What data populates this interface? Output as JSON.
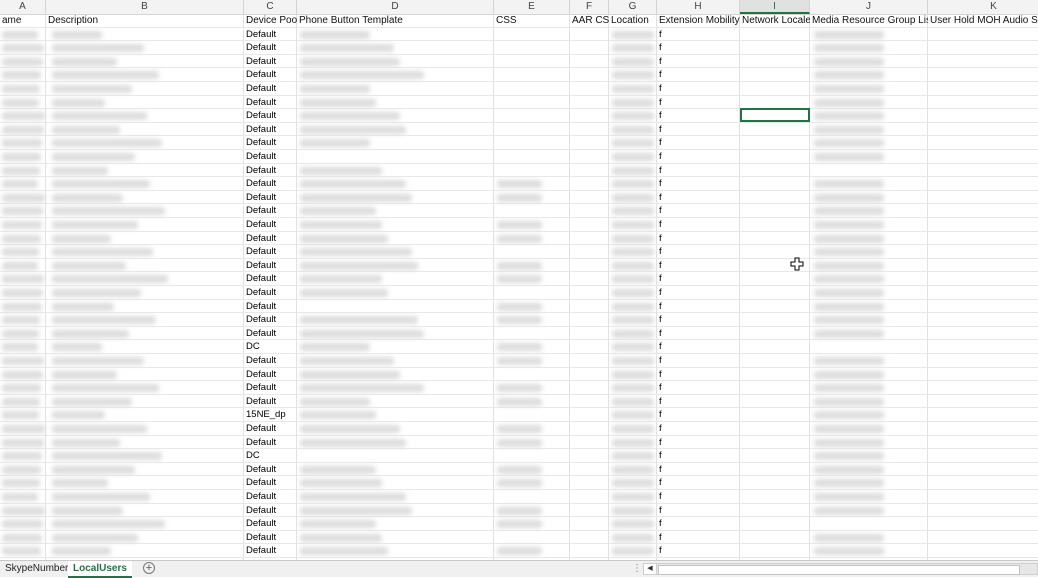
{
  "columns": [
    {
      "letter": "A",
      "header": "ame"
    },
    {
      "letter": "B",
      "header": "Description"
    },
    {
      "letter": "C",
      "header": "Device Pool"
    },
    {
      "letter": "D",
      "header": "Phone Button Template"
    },
    {
      "letter": "E",
      "header": "CSS"
    },
    {
      "letter": "F",
      "header": "AAR CSS"
    },
    {
      "letter": "G",
      "header": "Location"
    },
    {
      "letter": "H",
      "header": "Extension Mobility"
    },
    {
      "letter": "I",
      "header": "Network Locale"
    },
    {
      "letter": "J",
      "header": "Media Resource Group List"
    },
    {
      "letter": "K",
      "header": "User Hold MOH Audio So"
    }
  ],
  "active_column": "I",
  "rows": [
    {
      "pool": "Default",
      "em": "f"
    },
    {
      "pool": "Default",
      "em": "f"
    },
    {
      "pool": "Default",
      "em": "f"
    },
    {
      "pool": "Default",
      "em": "f"
    },
    {
      "pool": "Default",
      "em": "f"
    },
    {
      "pool": "Default",
      "em": "f"
    },
    {
      "pool": "Default",
      "em": "f"
    },
    {
      "pool": "Default",
      "em": "f"
    },
    {
      "pool": "Default",
      "em": "f"
    },
    {
      "pool": "Default",
      "em": "f"
    },
    {
      "pool": "Default",
      "em": "f"
    },
    {
      "pool": "Default",
      "em": "f"
    },
    {
      "pool": "Default",
      "em": "f"
    },
    {
      "pool": "Default",
      "em": "f"
    },
    {
      "pool": "Default",
      "em": "f"
    },
    {
      "pool": "Default",
      "em": "f"
    },
    {
      "pool": "Default",
      "em": "f"
    },
    {
      "pool": "Default",
      "em": "f"
    },
    {
      "pool": "Default",
      "em": "f"
    },
    {
      "pool": "Default",
      "em": "f"
    },
    {
      "pool": "Default",
      "em": "f"
    },
    {
      "pool": "Default",
      "em": "f"
    },
    {
      "pool": "Default",
      "em": "f"
    },
    {
      "pool": "DC",
      "em": "f"
    },
    {
      "pool": "Default",
      "em": "f"
    },
    {
      "pool": "Default",
      "em": "f"
    },
    {
      "pool": "Default",
      "em": "f"
    },
    {
      "pool": "Default",
      "em": "f"
    },
    {
      "pool": "15NE_dp",
      "em": "f"
    },
    {
      "pool": "Default",
      "em": "f"
    },
    {
      "pool": "Default",
      "em": "f"
    },
    {
      "pool": "DC",
      "em": "f"
    },
    {
      "pool": "Default",
      "em": "f"
    },
    {
      "pool": "Default",
      "em": "f"
    },
    {
      "pool": "Default",
      "em": "f"
    },
    {
      "pool": "Default",
      "em": "f"
    },
    {
      "pool": "Default",
      "em": "f"
    },
    {
      "pool": "Default",
      "em": "f"
    },
    {
      "pool": "Default",
      "em": "f"
    }
  ],
  "tabs": [
    {
      "label": "SkypeNumbers",
      "active": false
    },
    {
      "label": "LocalUsers",
      "active": true
    }
  ],
  "add_sheet_label": "+",
  "colors": {
    "accent": "#217346",
    "grid": "#e1e1e1",
    "header_bg": "#f3f3f3"
  }
}
